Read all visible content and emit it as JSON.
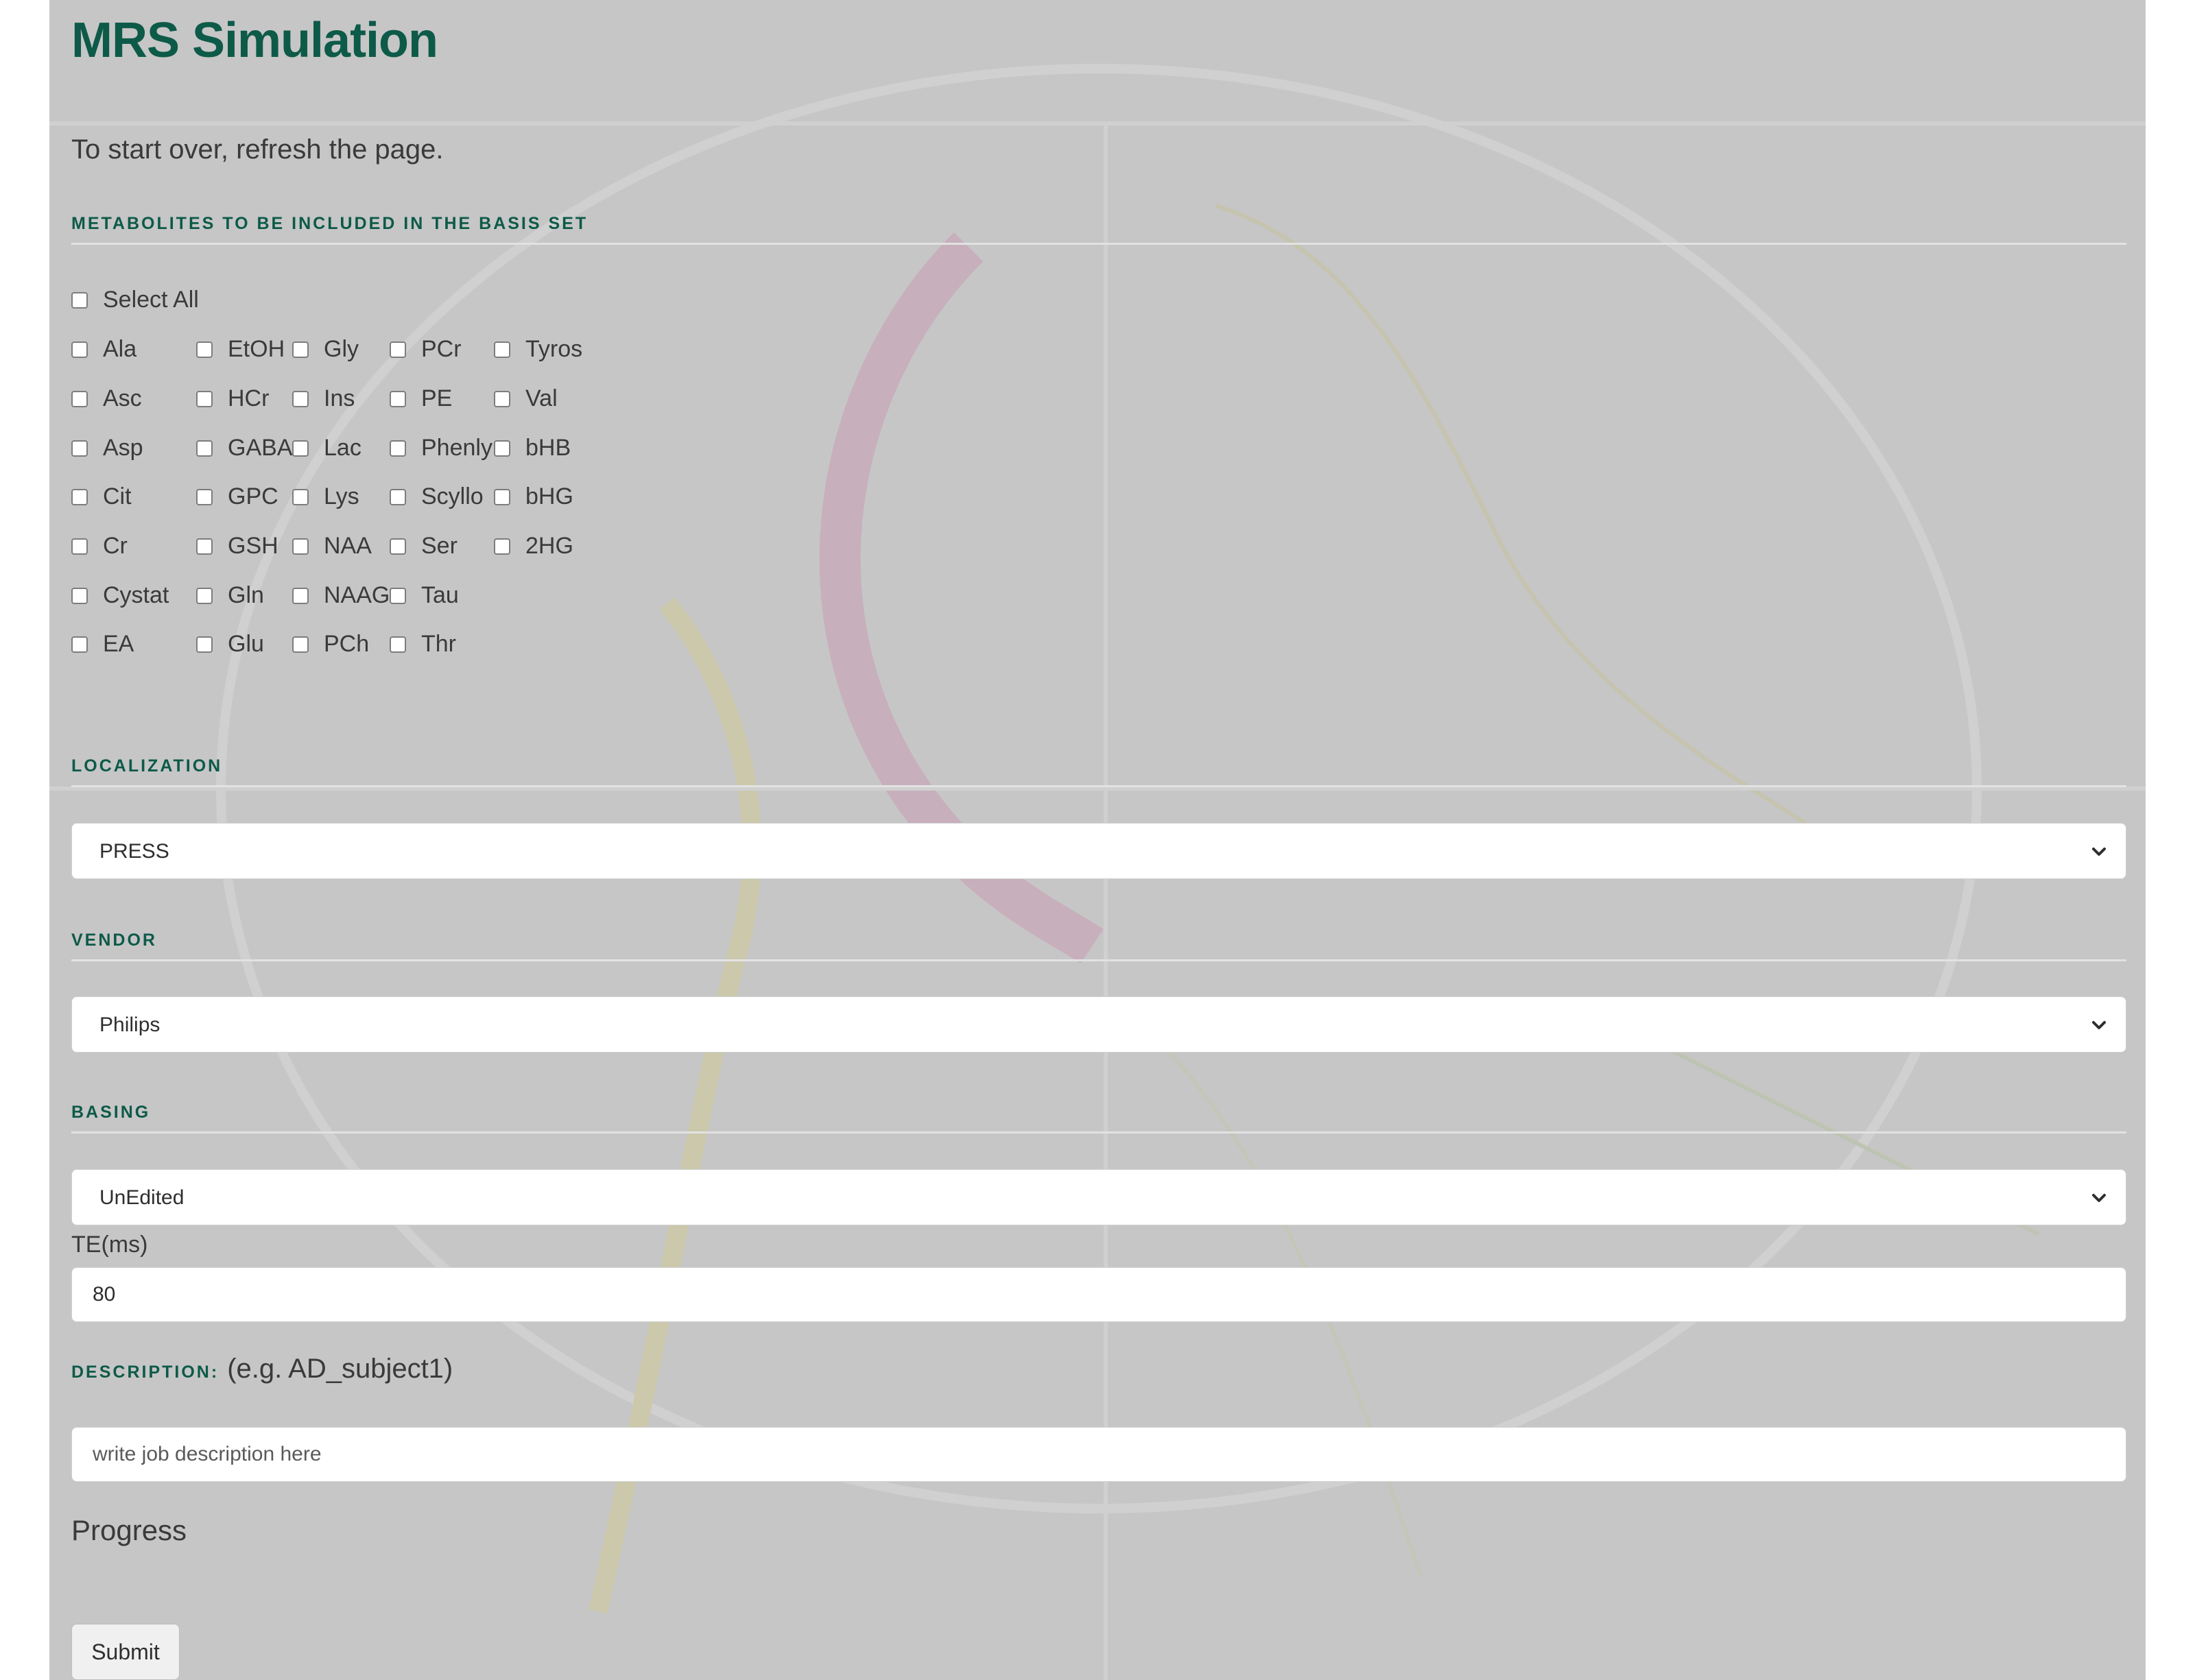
{
  "page": {
    "title": "MRS Simulation",
    "intro": "To start over, refresh the page."
  },
  "metabolites": {
    "section_label": "Metabolites to be included in the Basis Set",
    "select_all_label": "Select All",
    "columns": [
      [
        "Ala",
        "Asc",
        "Asp",
        "Cit",
        "Cr",
        "Cystat",
        "EA"
      ],
      [
        "EtOH",
        "HCr",
        "GABA",
        "GPC",
        "GSH",
        "Gln",
        "Glu"
      ],
      [
        "Gly",
        "Ins",
        "Lac",
        "Lys",
        "NAA",
        "NAAG",
        "PCh"
      ],
      [
        "PCr",
        "PE",
        "Phenly",
        "Scyllo",
        "Ser",
        "Tau",
        "Thr"
      ],
      [
        "Tyros",
        "Val",
        "bHB",
        "bHG",
        "2HG"
      ]
    ]
  },
  "localization": {
    "section_label": "Localization",
    "selected": "PRESS"
  },
  "vendor": {
    "section_label": "Vendor",
    "selected": "Philips"
  },
  "basing": {
    "section_label": "Basing",
    "selected": "UnEdited"
  },
  "te": {
    "label": "TE(ms)",
    "value": "80"
  },
  "description": {
    "section_label": "Description:",
    "hint": "(e.g. AD_subject1)",
    "placeholder": "write job description here"
  },
  "progress": {
    "heading": "Progress"
  },
  "actions": {
    "submit_label": "Submit"
  },
  "icons": {
    "dropdown": "chevron-down-icon"
  },
  "colors": {
    "accent": "#0d5a48",
    "panel_background": "#c6c6c6",
    "text": "#3a3a3a"
  }
}
